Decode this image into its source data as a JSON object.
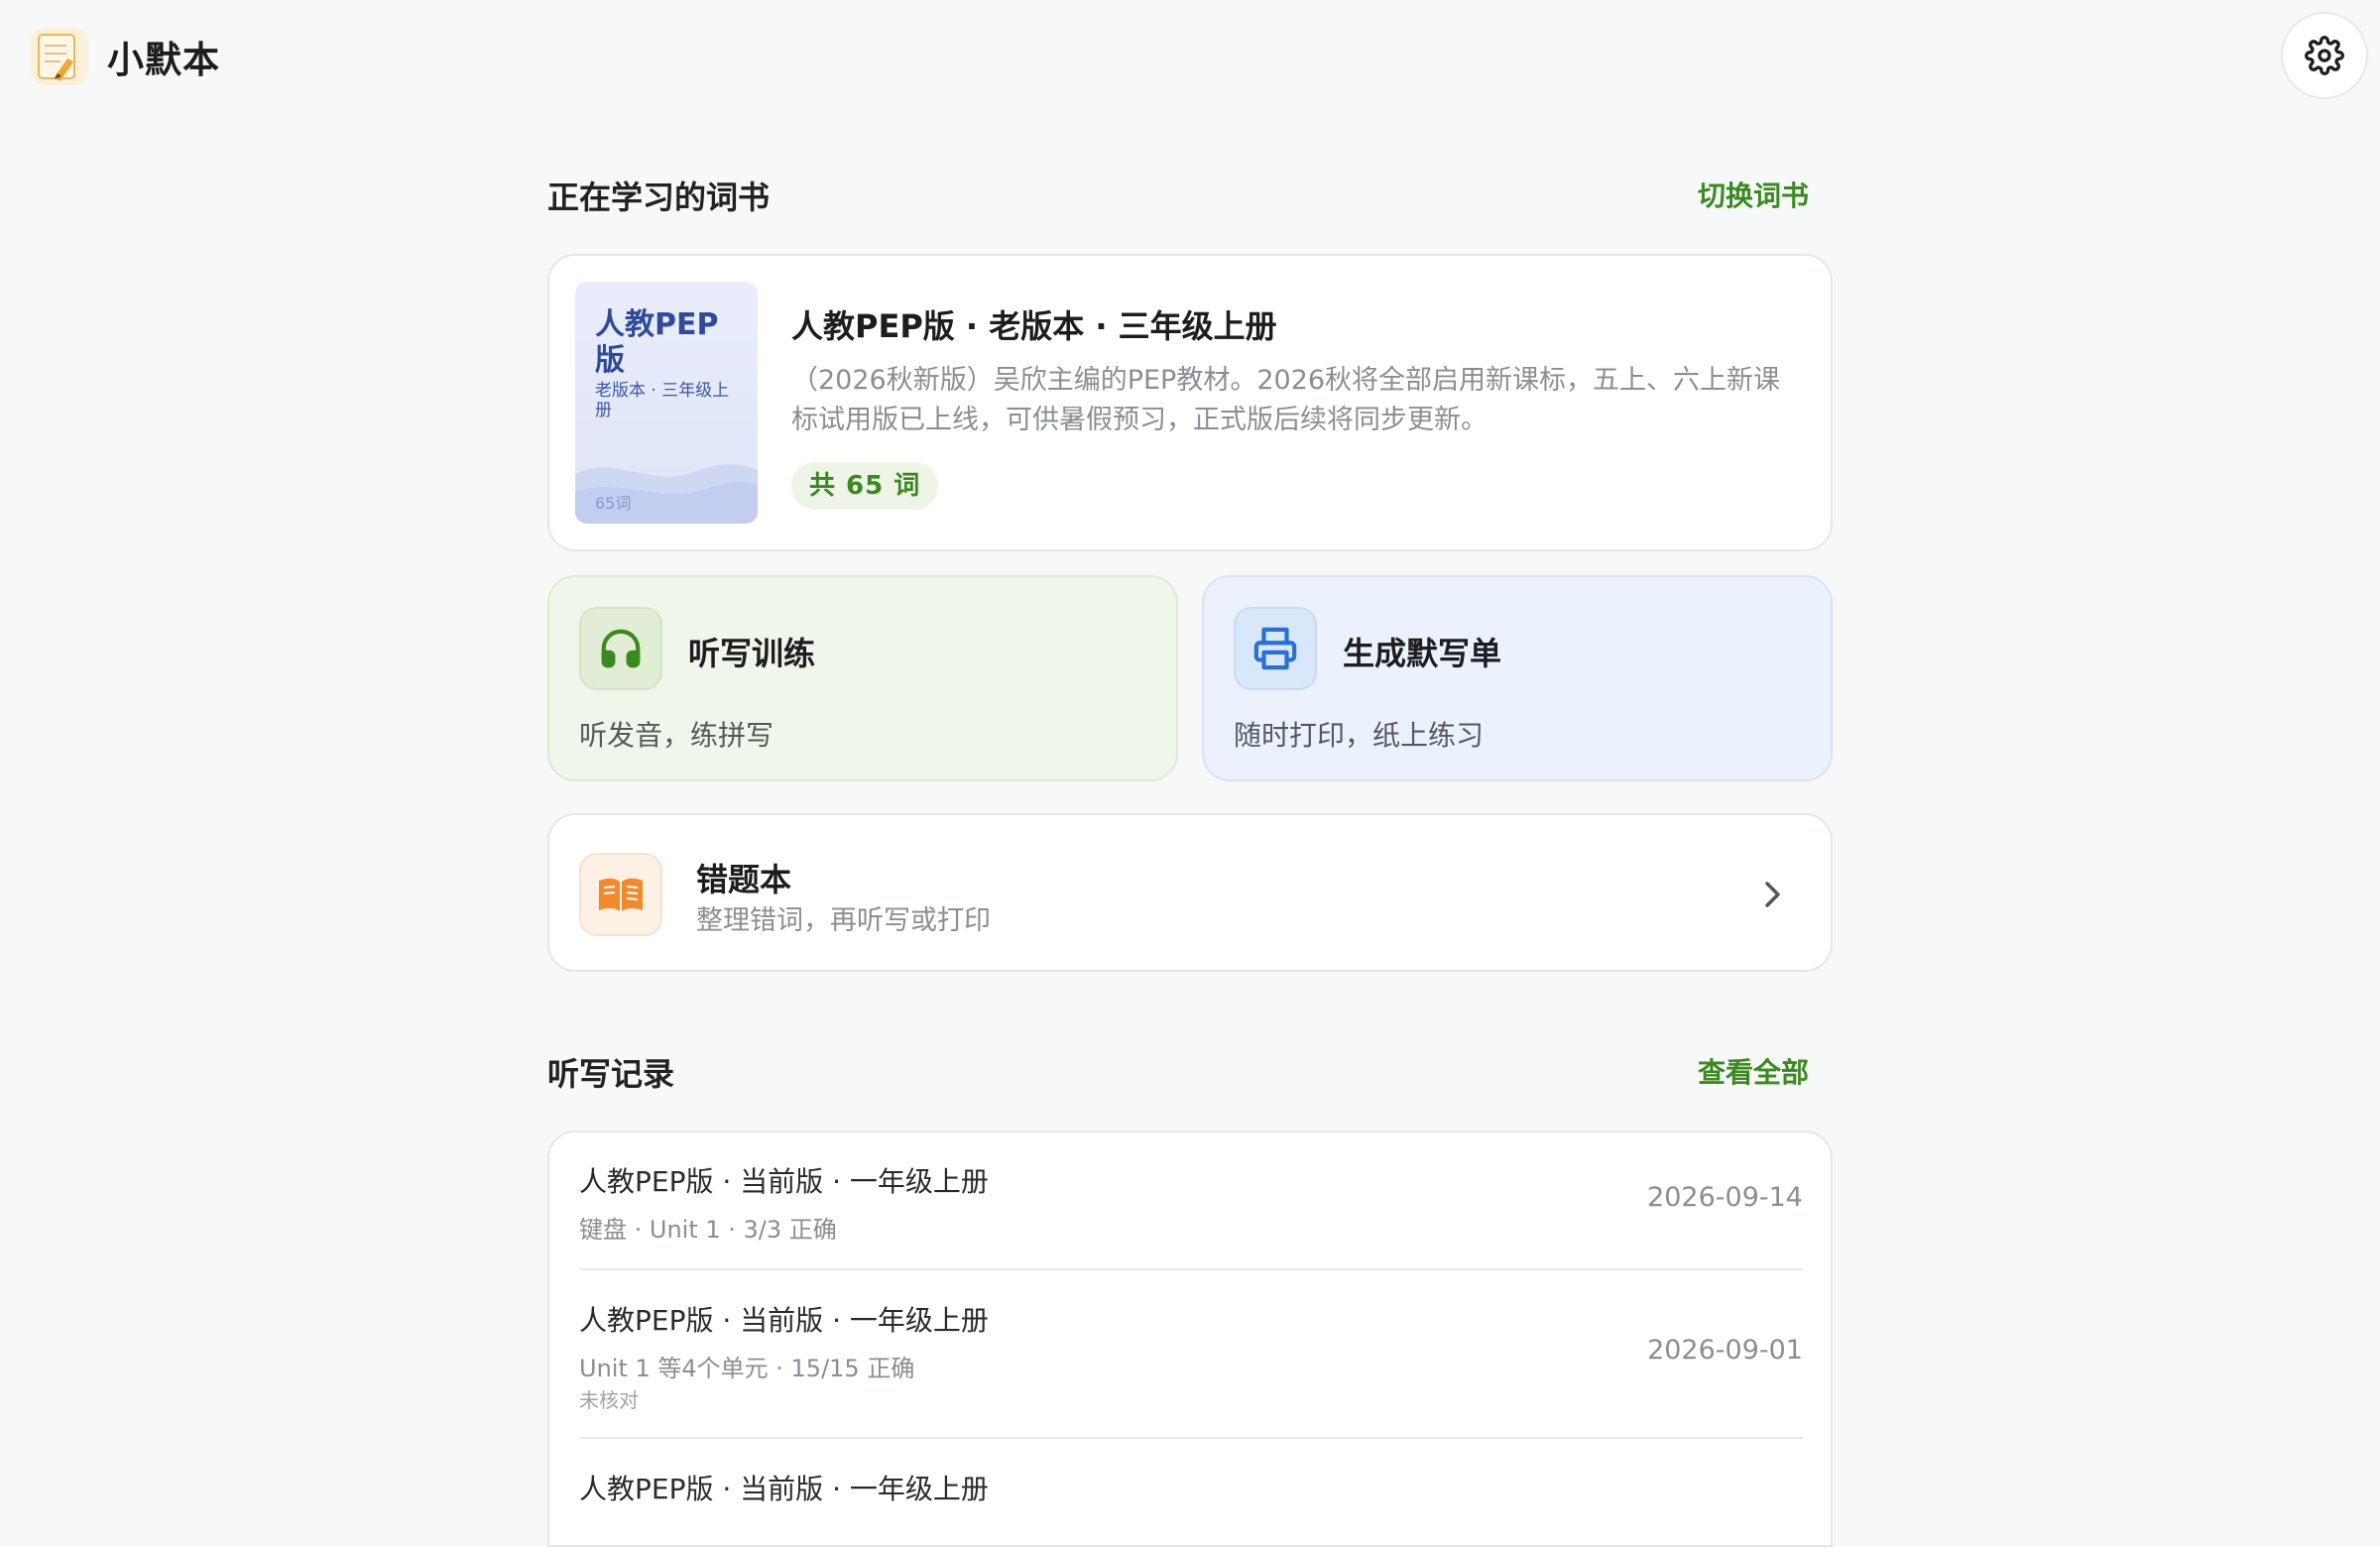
{
  "app": {
    "title": "小默本",
    "logo_icon": "notebook-pencil-icon",
    "settings_icon": "gear-icon"
  },
  "current_book_section": {
    "title": "正在学习的词书",
    "switch_label": "切换词书"
  },
  "book": {
    "cover_title": "人教PEP版",
    "cover_subtitle": "老版本 · 三年级上册",
    "cover_count": "65词",
    "title": "人教PEP版 · 老版本 · 三年级上册",
    "description": "（2026秋新版）吴欣主编的PEP教材。2026秋将全部启用新课标，五上、六上新课标试用版已上线，可供暑假预习，正式版后续将同步更新。",
    "word_count_label": "共 65 词"
  },
  "actions": {
    "dictation": {
      "title": "听写训练",
      "subtitle": "听发音，练拼写",
      "icon": "headphones-icon",
      "accent": "#3a8a1f"
    },
    "print": {
      "title": "生成默写单",
      "subtitle": "随时打印，纸上练习",
      "icon": "printer-icon",
      "accent": "#2a6fd6"
    }
  },
  "mistakes": {
    "title": "错题本",
    "subtitle": "整理错词，再听写或打印",
    "icon": "open-book-icon",
    "chevron_icon": "chevron-right-icon"
  },
  "records_section": {
    "title": "听写记录",
    "view_all_label": "查看全部"
  },
  "records": [
    {
      "title": "人教PEP版 · 当前版 · 一年级上册",
      "meta": "键盘 · Unit 1 · 3/3 正确",
      "note": "",
      "date": "2026-09-14"
    },
    {
      "title": "人教PEP版 · 当前版 · 一年级上册",
      "meta": "Unit 1 等4个单元 · 15/15 正确",
      "note": "未核对",
      "date": "2026-09-01"
    },
    {
      "title": "人教PEP版 · 当前版 · 一年级上册",
      "meta": "",
      "note": "",
      "date": ""
    }
  ],
  "colors": {
    "brand_green": "#3a8a1f",
    "dictation_bg": "#f0f6ea",
    "print_bg": "#ebf2fd",
    "mistake_accent": "#f08a2c"
  }
}
